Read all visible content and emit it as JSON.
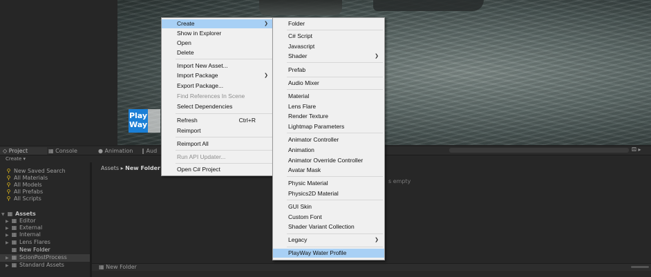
{
  "tabs": {
    "project": "Project",
    "console": "Console",
    "animation": "Animation",
    "audio": "Aud"
  },
  "scene": {
    "logo_text": "Play Way",
    "controls": "⚄ ▸"
  },
  "project_panel": {
    "create_label": "Create ▾",
    "favorites": [
      {
        "label": "New Saved Search"
      },
      {
        "label": "All Materials"
      },
      {
        "label": "All Models"
      },
      {
        "label": "All Prefabs"
      },
      {
        "label": "All Scripts"
      }
    ],
    "assets_label": "Assets",
    "asset_folders": [
      {
        "label": "Editor"
      },
      {
        "label": "External"
      },
      {
        "label": "Internal"
      },
      {
        "label": "Lens Flares"
      },
      {
        "label": "New Folder"
      },
      {
        "label": "ScionPostProcess"
      },
      {
        "label": "Standard Assets"
      }
    ],
    "breadcrumb_root": "Assets",
    "breadcrumb_sep": "▸",
    "breadcrumb_current": "New Folder",
    "empty_message": "s empty",
    "bottom_path": "New Folder"
  },
  "context_menu": {
    "items": [
      {
        "label": "Create",
        "submenu": true,
        "highlighted": true
      },
      {
        "label": "Show in Explorer"
      },
      {
        "label": "Open"
      },
      {
        "label": "Delete"
      },
      {
        "label": "Import New Asset..."
      },
      {
        "label": "Import Package",
        "submenu": true
      },
      {
        "label": "Export Package..."
      },
      {
        "label": "Find References In Scene",
        "disabled": true
      },
      {
        "label": "Select Dependencies"
      },
      {
        "label": "Refresh",
        "shortcut": "Ctrl+R"
      },
      {
        "label": "Reimport"
      },
      {
        "label": "Reimport All"
      },
      {
        "label": "Run API Updater...",
        "disabled": true
      },
      {
        "label": "Open C# Project"
      }
    ]
  },
  "create_submenu": {
    "items": [
      {
        "label": "Folder"
      },
      {
        "label": "C# Script"
      },
      {
        "label": "Javascript"
      },
      {
        "label": "Shader",
        "submenu": true
      },
      {
        "label": "Prefab"
      },
      {
        "label": "Audio Mixer"
      },
      {
        "label": "Material"
      },
      {
        "label": "Lens Flare"
      },
      {
        "label": "Render Texture"
      },
      {
        "label": "Lightmap Parameters"
      },
      {
        "label": "Animator Controller"
      },
      {
        "label": "Animation"
      },
      {
        "label": "Animator Override Controller"
      },
      {
        "label": "Avatar Mask"
      },
      {
        "label": "Physic Material"
      },
      {
        "label": "Physics2D Material"
      },
      {
        "label": "GUI Skin"
      },
      {
        "label": "Custom Font"
      },
      {
        "label": "Shader Variant Collection"
      },
      {
        "label": "Legacy",
        "submenu": true
      },
      {
        "label": "PlayWay Water Profile",
        "highlighted": true
      }
    ]
  },
  "colors": {
    "menu_bg": "#f0f0f0",
    "menu_highlight": "#a8d0f5",
    "search_icon": "#e0b81b",
    "logo_blue": "#1a7fd6"
  }
}
